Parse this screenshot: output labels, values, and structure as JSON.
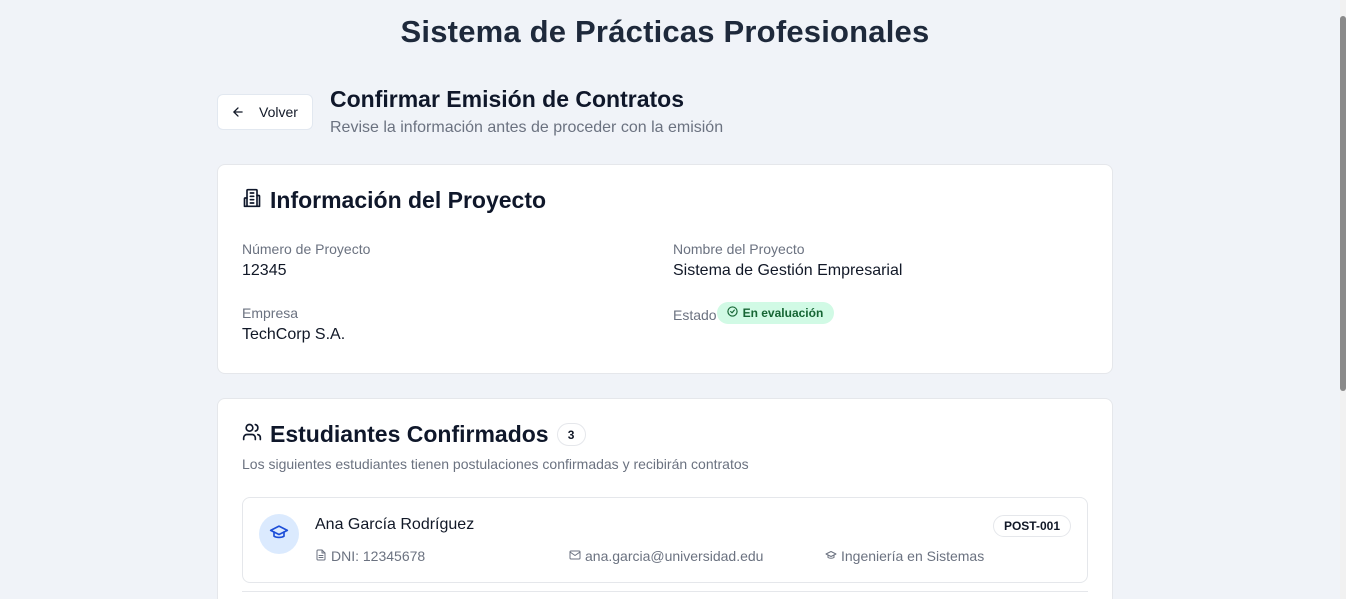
{
  "app": {
    "title": "Sistema de Prácticas Profesionales"
  },
  "header": {
    "back_label": "Volver",
    "title": "Confirmar Emisión de Contratos",
    "subtitle": "Revise la información antes de proceder con la emisión"
  },
  "project": {
    "title": "Información del Proyecto",
    "numero_label": "Número de Proyecto",
    "numero_value": "12345",
    "nombre_label": "Nombre del Proyecto",
    "nombre_value": "Sistema de Gestión Empresarial",
    "empresa_label": "Empresa",
    "empresa_value": "TechCorp S.A.",
    "estado_label": "Estado",
    "estado_value": "En evaluación"
  },
  "students": {
    "title": "Estudiantes Confirmados",
    "count": "3",
    "description": "Los siguientes estudiantes tienen postulaciones confirmadas y recibirán contratos",
    "items": [
      {
        "name": "Ana García Rodríguez",
        "code": "POST-001",
        "dni": "DNI: 12345678",
        "email": "ana.garcia@universidad.edu",
        "carrera": "Ingeniería en Sistemas"
      }
    ]
  },
  "colors": {
    "background": "#f0f3f8",
    "status_badge_bg": "#d1fae5",
    "status_badge_text": "#166534",
    "avatar_bg": "#dbeafe",
    "avatar_icon": "#1d4ed8"
  },
  "icons": {
    "back": "arrow-left-icon",
    "project": "building-icon",
    "status": "check-circle-icon",
    "students": "users-icon",
    "avatar": "graduation-cap-icon",
    "dni": "file-icon",
    "email": "mail-icon",
    "carrera": "graduation-cap-icon"
  }
}
